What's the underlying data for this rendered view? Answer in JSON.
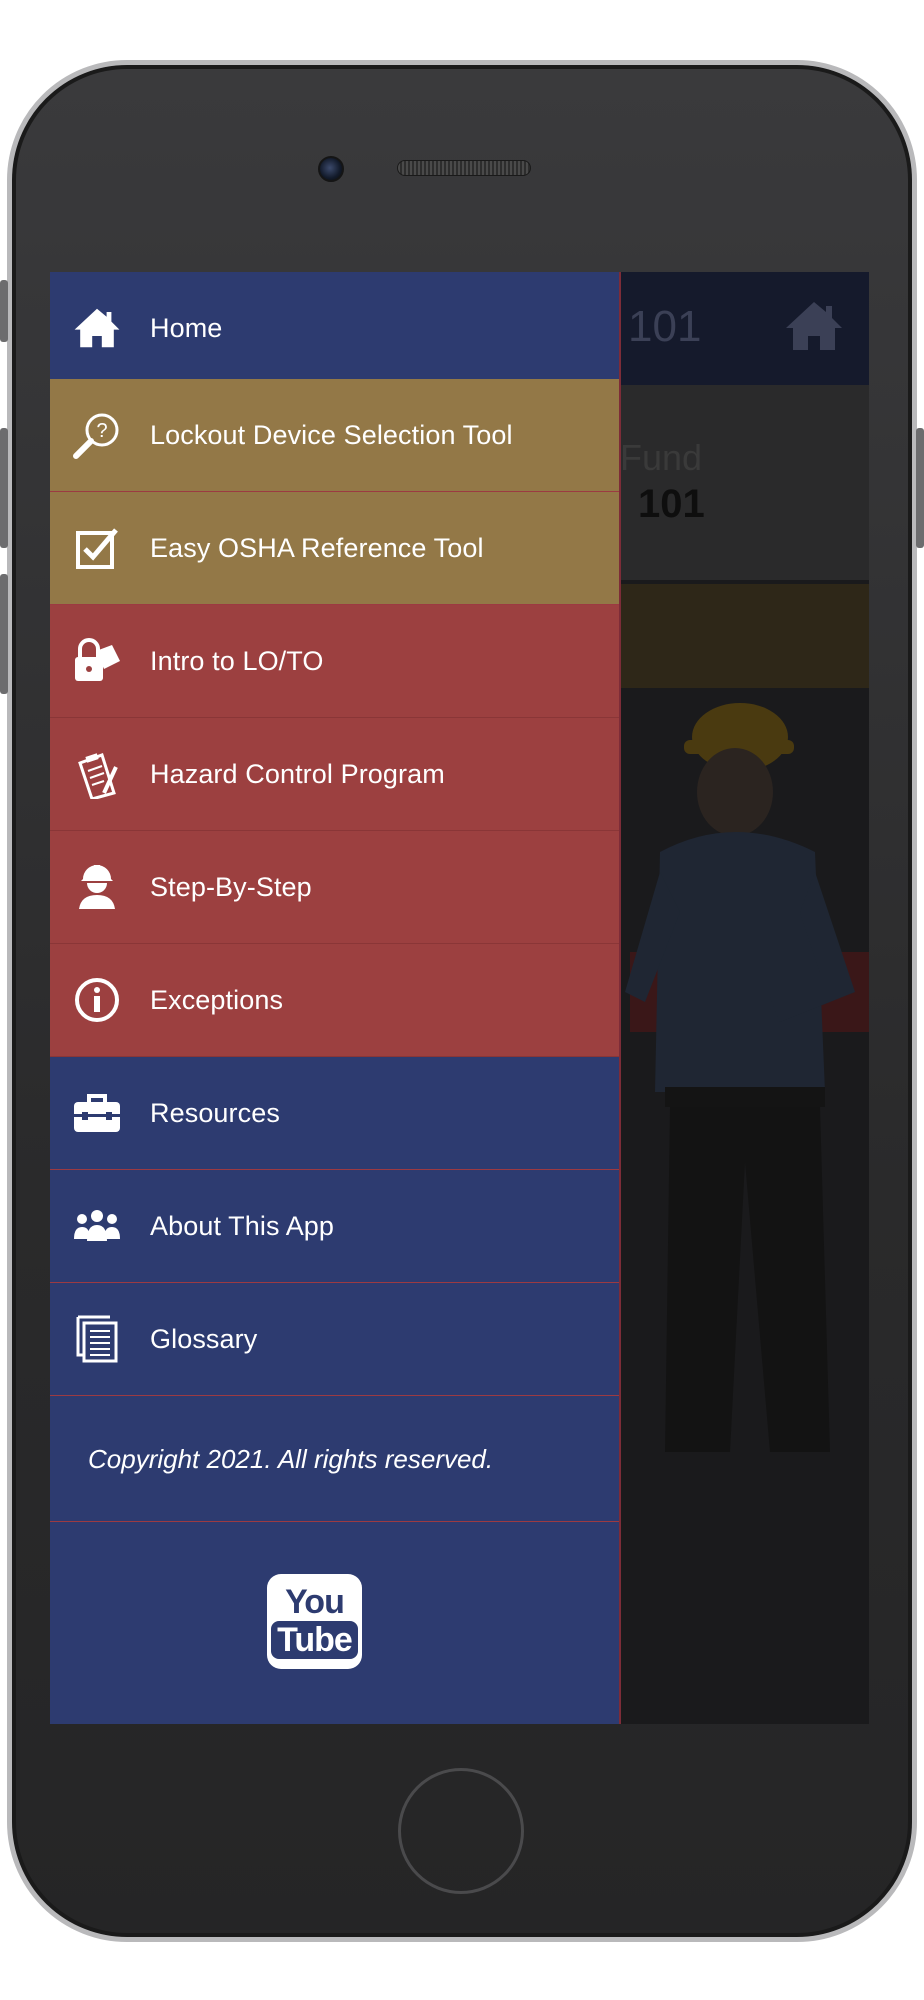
{
  "background_app": {
    "header_title": "101",
    "banner_line1": "Fund",
    "banner_line2": "101"
  },
  "drawer": {
    "items": [
      {
        "label": "Home",
        "icon": "home-icon",
        "color": "blue"
      },
      {
        "label": "Lockout Device Selection Tool",
        "icon": "magnifier-question-icon",
        "color": "gold"
      },
      {
        "label": "Easy OSHA Reference Tool",
        "icon": "checkbox-icon",
        "color": "gold"
      },
      {
        "label": "Intro to LO/TO",
        "icon": "lock-tag-icon",
        "color": "red"
      },
      {
        "label": "Hazard Control Program",
        "icon": "clipboard-pen-icon",
        "color": "red"
      },
      {
        "label": "Step-By-Step",
        "icon": "worker-hardhat-icon",
        "color": "red"
      },
      {
        "label": "Exceptions",
        "icon": "info-icon",
        "color": "red"
      },
      {
        "label": "Resources",
        "icon": "toolbox-icon",
        "color": "blue"
      },
      {
        "label": "About This App",
        "icon": "people-icon",
        "color": "blue"
      },
      {
        "label": "Glossary",
        "icon": "document-list-icon",
        "color": "blue"
      }
    ],
    "copyright": "Copyright 2021. All rights reserved.",
    "youtube": {
      "top": "You",
      "bottom": "Tube",
      "icon": "youtube-icon"
    }
  },
  "colors": {
    "drawer_blue": "#2d3b70",
    "drawer_gold": "#937847",
    "drawer_red": "#9c4040",
    "divider": "#9c3a42"
  }
}
